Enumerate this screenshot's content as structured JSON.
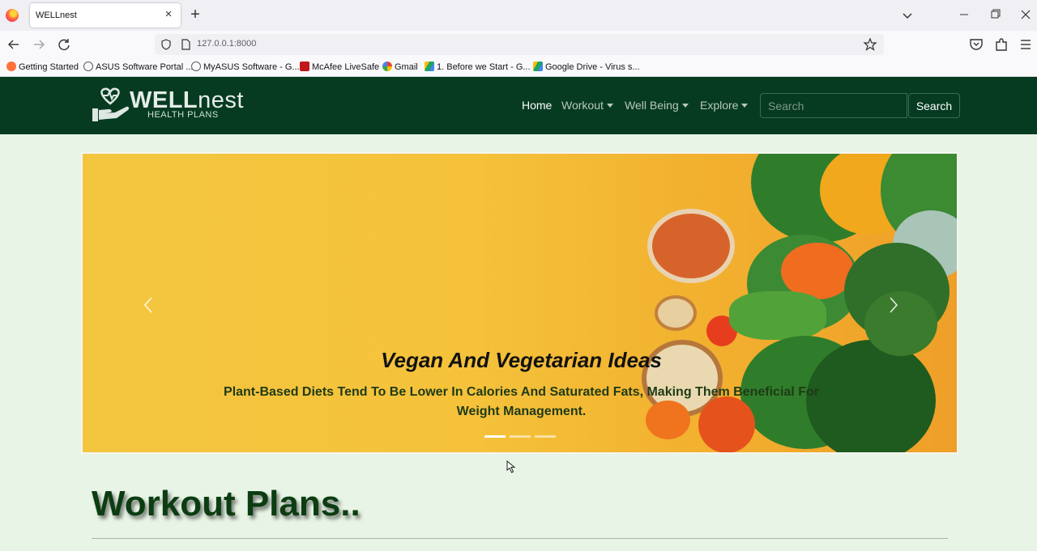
{
  "browser": {
    "tab_title": "WELLnest",
    "close_tab_glyph": "×",
    "new_tab_glyph": "+",
    "url": "127.0.0.1:8000",
    "bookmarks": [
      {
        "label": "Getting Started",
        "icon": "firefox-icon",
        "color": "#ff7139"
      },
      {
        "label": "ASUS Software Portal ...",
        "icon": "globe-icon",
        "color": "#5b5b66"
      },
      {
        "label": "MyASUS Software - G...",
        "icon": "globe-icon",
        "color": "#5b5b66"
      },
      {
        "label": "McAfee LiveSafe",
        "icon": "mcafee-icon",
        "color": "#c01818"
      },
      {
        "label": "Gmail",
        "icon": "google-icon",
        "color": "#4285f4"
      },
      {
        "label": "1. Before we Start - G...",
        "icon": "drive-icon",
        "color": "#1fa463"
      },
      {
        "label": "Google Drive - Virus s...",
        "icon": "drive-icon",
        "color": "#1fa463"
      }
    ]
  },
  "site": {
    "logo_word_bold": "WELL",
    "logo_word_rest": "nest",
    "logo_sub": "HEALTH PLANS",
    "menu": [
      {
        "label": "Home",
        "active": true,
        "dropdown": false
      },
      {
        "label": "Workout",
        "active": false,
        "dropdown": true
      },
      {
        "label": "Well Being",
        "active": false,
        "dropdown": true
      },
      {
        "label": "Explore",
        "active": false,
        "dropdown": true
      }
    ],
    "search_placeholder": "Search",
    "search_button": "Search"
  },
  "carousel": {
    "title": "Vegan And Vegetarian Ideas",
    "text": "Plant-Based Diets Tend To Be Lower In Calories And Saturated Fats, Making Them Beneficial For Weight Management.",
    "slide_count": 3,
    "active_slide": 1
  },
  "section": {
    "title": "Workout Plans.."
  },
  "colors": {
    "header_bg": "#063b22",
    "page_bg": "#e8f5e6",
    "accent_green": "#0c3d12"
  }
}
